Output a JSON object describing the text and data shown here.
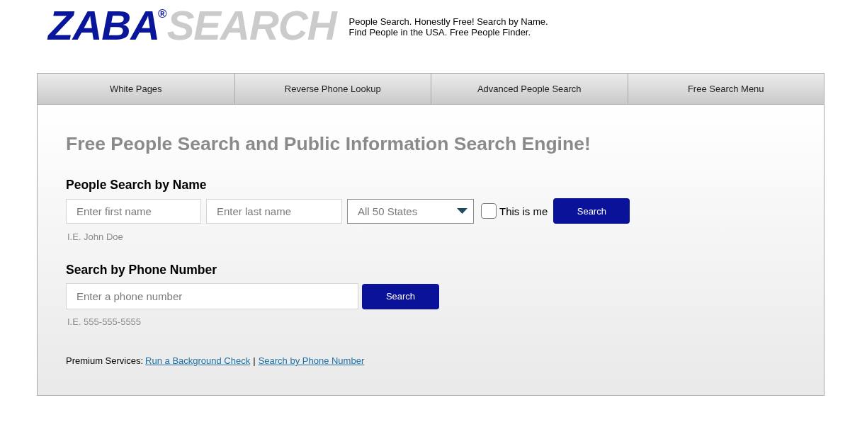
{
  "logo": {
    "primary": "ZABA",
    "mark": "®",
    "secondary": "SEARCH"
  },
  "tagline": [
    "People Search. Honestly Free! Search by Name.",
    "Find People in the USA. Free People Finder."
  ],
  "nav_links": [
    {
      "label": "White Pages"
    },
    {
      "label": "Reverse Phone Lookup"
    },
    {
      "label": "Advanced People Search"
    },
    {
      "label": "Free Search Menu"
    }
  ],
  "headline": "Free People Search and Public Information Search Engine!",
  "name_search": {
    "title": "People Search by Name",
    "first_name": {
      "placeholder": "Enter first name"
    },
    "last_name": {
      "placeholder": "Enter last name"
    },
    "state": {
      "value": "All 50 States"
    },
    "this_is_me": {
      "label": "This is me",
      "checked": false
    },
    "button": "Search",
    "hint": "I.E. John Doe"
  },
  "phone_search": {
    "title": "Search by Phone Number",
    "phone": {
      "placeholder": "Enter a phone number"
    },
    "button": "Search",
    "hint": "I.E. 555-555-5555"
  },
  "premium": {
    "label": "Premium Services:",
    "links": [
      "Run a Background Check",
      "Search by Phone Number"
    ],
    "separator": "|"
  }
}
